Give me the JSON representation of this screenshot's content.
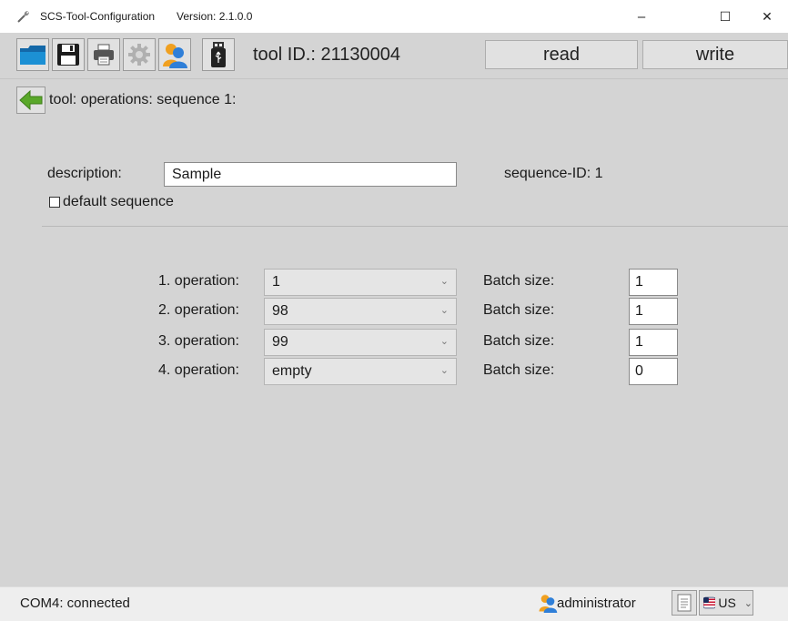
{
  "window": {
    "title": "SCS-Tool-Configuration",
    "version": "Version: 2.1.0.0",
    "minimize": "–",
    "maximize": "☐",
    "close": "✕"
  },
  "toolbar": {
    "tool_id": "tool ID.: 21130004",
    "read_label": "read",
    "write_label": "write",
    "icons": [
      "folder-icon",
      "save-icon",
      "print-icon",
      "settings-icon",
      "user-icon",
      "usb-icon"
    ]
  },
  "breadcrumb": "tool: operations: sequence 1:",
  "form": {
    "description_label": "description:",
    "description_value": "Sample",
    "sequence_id": "sequence-ID:  1",
    "default_sequence_label": "default sequence",
    "default_sequence_checked": false
  },
  "operations": [
    {
      "label": "1. operation:",
      "value": "1",
      "batch_label": "Batch size:",
      "batch_value": "1"
    },
    {
      "label": "2. operation:",
      "value": "98",
      "batch_label": "Batch size:",
      "batch_value": "1"
    },
    {
      "label": "3. operation:",
      "value": "99",
      "batch_label": "Batch size:",
      "batch_value": "1"
    },
    {
      "label": "4. operation:",
      "value": "empty",
      "batch_label": "Batch size:",
      "batch_value": "0"
    }
  ],
  "status": {
    "connection": "COM4: connected",
    "user": "administrator",
    "language": "US"
  },
  "colors": {
    "panel": "#d4d4d4",
    "folder": "#1c86c8",
    "back_arrow": "#5aa82a",
    "user_orange": "#f0a020",
    "user_blue": "#2f7fd8"
  }
}
